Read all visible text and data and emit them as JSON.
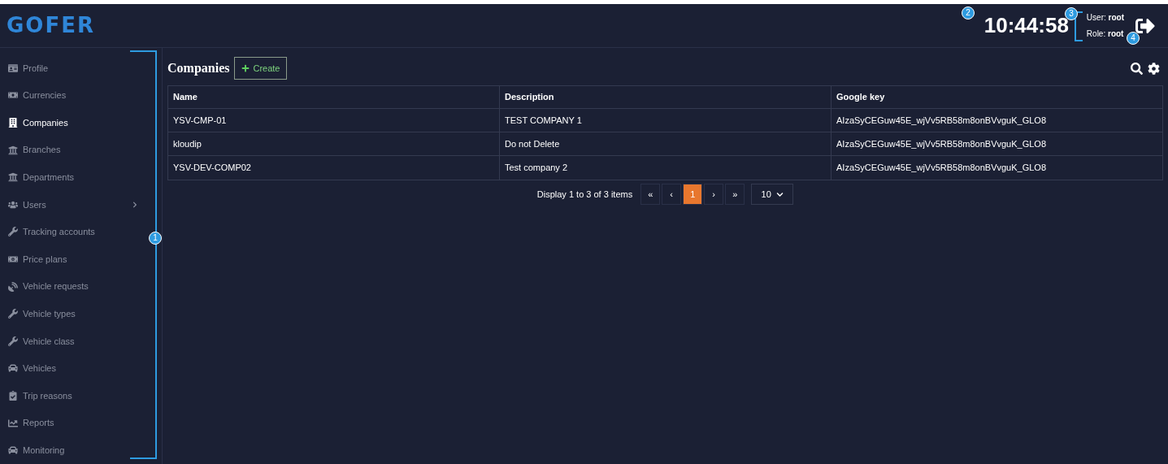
{
  "header": {
    "logo": "GOFER",
    "clock": "10:44:58",
    "user_label": "User:",
    "user": "root",
    "role_label": "Role:",
    "role": "root"
  },
  "sidebar": {
    "items": [
      {
        "label": "Profile",
        "selected": false,
        "expandable": false
      },
      {
        "label": "Currencies",
        "selected": false,
        "expandable": false
      },
      {
        "label": "Companies",
        "selected": true,
        "expandable": false
      },
      {
        "label": "Branches",
        "selected": false,
        "expandable": false
      },
      {
        "label": "Departments",
        "selected": false,
        "expandable": false
      },
      {
        "label": "Users",
        "selected": false,
        "expandable": true
      },
      {
        "label": "Tracking accounts",
        "selected": false,
        "expandable": false
      },
      {
        "label": "Price plans",
        "selected": false,
        "expandable": false
      },
      {
        "label": "Vehicle requests",
        "selected": false,
        "expandable": false
      },
      {
        "label": "Vehicle types",
        "selected": false,
        "expandable": false
      },
      {
        "label": "Vehicle class",
        "selected": false,
        "expandable": false
      },
      {
        "label": "Vehicles",
        "selected": false,
        "expandable": false
      },
      {
        "label": "Trip reasons",
        "selected": false,
        "expandable": false
      },
      {
        "label": "Reports",
        "selected": false,
        "expandable": false
      },
      {
        "label": "Monitoring",
        "selected": false,
        "expandable": false
      }
    ]
  },
  "page": {
    "title": "Companies",
    "create_button": "Create"
  },
  "table": {
    "columns": [
      "Name",
      "Description",
      "Google key"
    ],
    "rows": [
      [
        "YSV-CMP-01",
        "TEST COMPANY 1",
        "AIzaSyCEGuw45E_wjVv5RB58m8onBVvguK_GLO8"
      ],
      [
        "kloudip",
        "Do not Delete",
        "AIzaSyCEGuw45E_wjVv5RB58m8onBVvguK_GLO8"
      ],
      [
        "YSV-DEV-COMP02",
        "Test company 2",
        "AIzaSyCEGuw45E_wjVv5RB58m8onBVvguK_GLO8"
      ]
    ]
  },
  "pagination": {
    "summary": "Display 1 to 3 of 3 items",
    "buttons": [
      {
        "label": "«",
        "selected": false
      },
      {
        "label": "‹",
        "selected": false
      },
      {
        "label": "1",
        "selected": true
      },
      {
        "label": "›",
        "selected": false
      },
      {
        "label": "»",
        "selected": false
      }
    ],
    "page_size": "10"
  },
  "callouts": [
    "1",
    "2",
    "3",
    "4"
  ]
}
